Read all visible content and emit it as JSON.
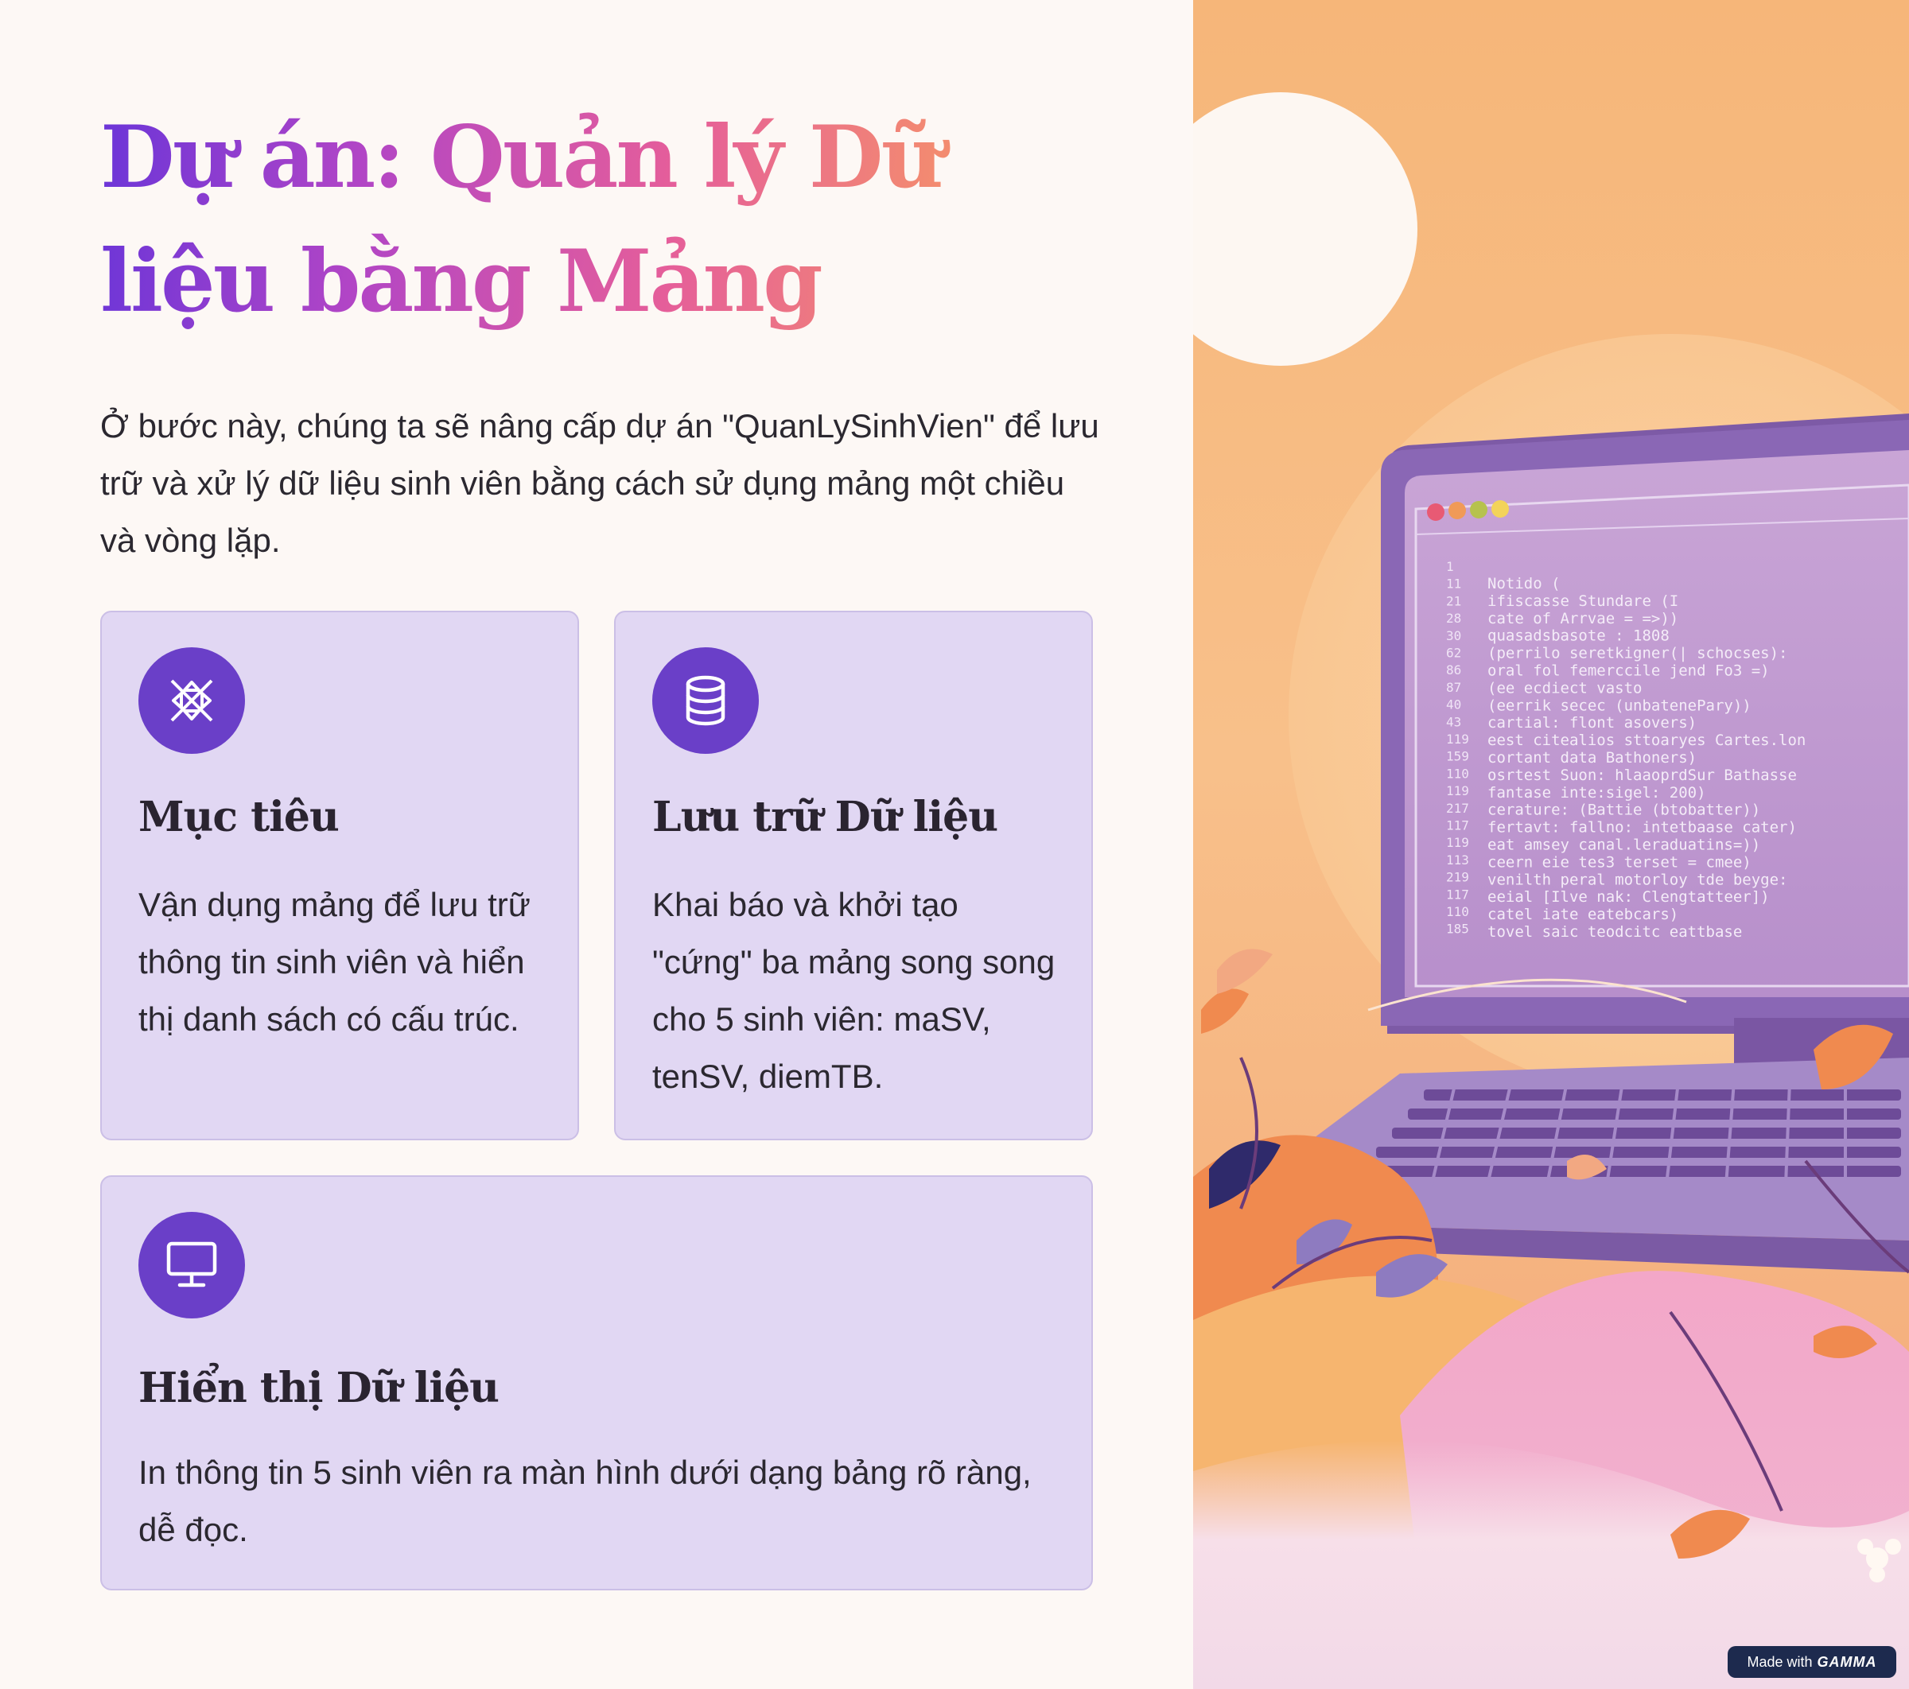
{
  "title": "Dự án: Quản lý Dữ liệu bằng Mảng",
  "intro": "Ở bước này, chúng ta sẽ nâng cấp dự án \"QuanLySinhVien\" để lưu trữ và xử lý dữ liệu sinh viên bằng cách sử dụng mảng một chiều và vòng lặp.",
  "cards": [
    {
      "icon": "x-arrows-icon",
      "title": "Mục tiêu",
      "text": "Vận dụng mảng để lưu trữ thông tin sinh viên và hiển thị danh sách có cấu trúc."
    },
    {
      "icon": "database-icon",
      "title": "Lưu trữ Dữ liệu",
      "text": "Khai báo và khởi tạo \"cứng\" ba mảng song song cho 5 sinh viên: maSV, tenSV, diemTB."
    },
    {
      "icon": "monitor-icon",
      "title": "Hiển thị Dữ liệu",
      "text": "In thông tin 5 sinh viên ra màn hình dưới dạng bảng rõ ràng, dễ đọc."
    }
  ],
  "illustration": {
    "code_lines": [
      "Notido (",
      "ifiscasse Stundare (I",
      "    cate of Arrvae = =>))",
      "    quasadsbasote : 1808",
      "    (perrilo seretkigner(| schocses):",
      "    oral fol femerccile jend Fo3 =)",
      "    (ee ecdiect vasto",
      "    (eerrik secec  (unbatenePary))",
      "    cartial: flont asovers)",
      "    eest citealios sttoaryes Cartes.lon",
      "    cortant data Bathoners)",
      "    osrtest Suon: hlaaoprdSur Bathasse",
      "    fantase inte:sigel: 200)",
      "    cerature: (Battie (btobatter))",
      "    fertavt: fallno: intetbaase cater)",
      "    eat amsey canal.leraduatins=))",
      "    ceern  eie tes3 terset = cmee)",
      "    venilth peral motorloy tde beyge:",
      "    eeial [Ilve nak: Clengtatteer])",
      "    catel iate eatebcars)",
      "    tovel saic teodcitc eattbase"
    ],
    "line_numbers": [
      "1",
      "11",
      "21",
      "28",
      "30",
      "62",
      "86",
      "87",
      "40",
      "43",
      "119",
      "159",
      "110",
      "119",
      "217",
      "117",
      "119",
      "113",
      "219",
      "117",
      "110",
      "185"
    ]
  },
  "badge": {
    "made_with": "Made with",
    "brand": "GAMMA"
  },
  "colors": {
    "accent": "#6a3fc8",
    "card_bg": "#e1d7f3",
    "page_bg": "#fdf8f5",
    "badge_bg": "#1d2a4e"
  }
}
